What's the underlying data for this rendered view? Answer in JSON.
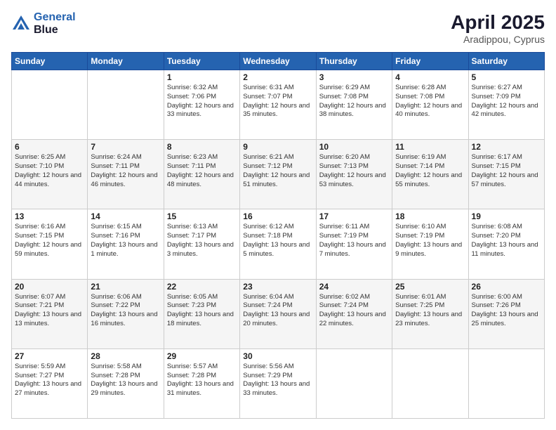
{
  "logo": {
    "line1": "General",
    "line2": "Blue"
  },
  "title": "April 2025",
  "subtitle": "Aradippou, Cyprus",
  "days_of_week": [
    "Sunday",
    "Monday",
    "Tuesday",
    "Wednesday",
    "Thursday",
    "Friday",
    "Saturday"
  ],
  "weeks": [
    {
      "row_class": "row-odd",
      "days": [
        {
          "day": "",
          "info": ""
        },
        {
          "day": "",
          "info": ""
        },
        {
          "day": "1",
          "info": "Sunrise: 6:32 AM\nSunset: 7:06 PM\nDaylight: 12 hours and 33 minutes."
        },
        {
          "day": "2",
          "info": "Sunrise: 6:31 AM\nSunset: 7:07 PM\nDaylight: 12 hours and 35 minutes."
        },
        {
          "day": "3",
          "info": "Sunrise: 6:29 AM\nSunset: 7:08 PM\nDaylight: 12 hours and 38 minutes."
        },
        {
          "day": "4",
          "info": "Sunrise: 6:28 AM\nSunset: 7:08 PM\nDaylight: 12 hours and 40 minutes."
        },
        {
          "day": "5",
          "info": "Sunrise: 6:27 AM\nSunset: 7:09 PM\nDaylight: 12 hours and 42 minutes."
        }
      ]
    },
    {
      "row_class": "row-even",
      "days": [
        {
          "day": "6",
          "info": "Sunrise: 6:25 AM\nSunset: 7:10 PM\nDaylight: 12 hours and 44 minutes."
        },
        {
          "day": "7",
          "info": "Sunrise: 6:24 AM\nSunset: 7:11 PM\nDaylight: 12 hours and 46 minutes."
        },
        {
          "day": "8",
          "info": "Sunrise: 6:23 AM\nSunset: 7:11 PM\nDaylight: 12 hours and 48 minutes."
        },
        {
          "day": "9",
          "info": "Sunrise: 6:21 AM\nSunset: 7:12 PM\nDaylight: 12 hours and 51 minutes."
        },
        {
          "day": "10",
          "info": "Sunrise: 6:20 AM\nSunset: 7:13 PM\nDaylight: 12 hours and 53 minutes."
        },
        {
          "day": "11",
          "info": "Sunrise: 6:19 AM\nSunset: 7:14 PM\nDaylight: 12 hours and 55 minutes."
        },
        {
          "day": "12",
          "info": "Sunrise: 6:17 AM\nSunset: 7:15 PM\nDaylight: 12 hours and 57 minutes."
        }
      ]
    },
    {
      "row_class": "row-odd",
      "days": [
        {
          "day": "13",
          "info": "Sunrise: 6:16 AM\nSunset: 7:15 PM\nDaylight: 12 hours and 59 minutes."
        },
        {
          "day": "14",
          "info": "Sunrise: 6:15 AM\nSunset: 7:16 PM\nDaylight: 13 hours and 1 minute."
        },
        {
          "day": "15",
          "info": "Sunrise: 6:13 AM\nSunset: 7:17 PM\nDaylight: 13 hours and 3 minutes."
        },
        {
          "day": "16",
          "info": "Sunrise: 6:12 AM\nSunset: 7:18 PM\nDaylight: 13 hours and 5 minutes."
        },
        {
          "day": "17",
          "info": "Sunrise: 6:11 AM\nSunset: 7:19 PM\nDaylight: 13 hours and 7 minutes."
        },
        {
          "day": "18",
          "info": "Sunrise: 6:10 AM\nSunset: 7:19 PM\nDaylight: 13 hours and 9 minutes."
        },
        {
          "day": "19",
          "info": "Sunrise: 6:08 AM\nSunset: 7:20 PM\nDaylight: 13 hours and 11 minutes."
        }
      ]
    },
    {
      "row_class": "row-even",
      "days": [
        {
          "day": "20",
          "info": "Sunrise: 6:07 AM\nSunset: 7:21 PM\nDaylight: 13 hours and 13 minutes."
        },
        {
          "day": "21",
          "info": "Sunrise: 6:06 AM\nSunset: 7:22 PM\nDaylight: 13 hours and 16 minutes."
        },
        {
          "day": "22",
          "info": "Sunrise: 6:05 AM\nSunset: 7:23 PM\nDaylight: 13 hours and 18 minutes."
        },
        {
          "day": "23",
          "info": "Sunrise: 6:04 AM\nSunset: 7:24 PM\nDaylight: 13 hours and 20 minutes."
        },
        {
          "day": "24",
          "info": "Sunrise: 6:02 AM\nSunset: 7:24 PM\nDaylight: 13 hours and 22 minutes."
        },
        {
          "day": "25",
          "info": "Sunrise: 6:01 AM\nSunset: 7:25 PM\nDaylight: 13 hours and 23 minutes."
        },
        {
          "day": "26",
          "info": "Sunrise: 6:00 AM\nSunset: 7:26 PM\nDaylight: 13 hours and 25 minutes."
        }
      ]
    },
    {
      "row_class": "row-odd",
      "days": [
        {
          "day": "27",
          "info": "Sunrise: 5:59 AM\nSunset: 7:27 PM\nDaylight: 13 hours and 27 minutes."
        },
        {
          "day": "28",
          "info": "Sunrise: 5:58 AM\nSunset: 7:28 PM\nDaylight: 13 hours and 29 minutes."
        },
        {
          "day": "29",
          "info": "Sunrise: 5:57 AM\nSunset: 7:28 PM\nDaylight: 13 hours and 31 minutes."
        },
        {
          "day": "30",
          "info": "Sunrise: 5:56 AM\nSunset: 7:29 PM\nDaylight: 13 hours and 33 minutes."
        },
        {
          "day": "",
          "info": ""
        },
        {
          "day": "",
          "info": ""
        },
        {
          "day": "",
          "info": ""
        }
      ]
    }
  ]
}
